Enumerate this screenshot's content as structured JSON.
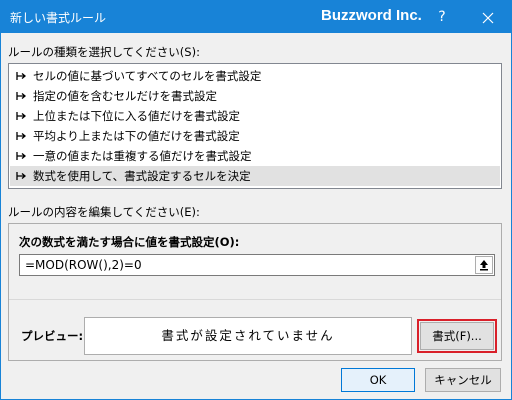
{
  "window": {
    "title": "新しい書式ルール",
    "brand": "Buzzword Inc.",
    "help_label": "?"
  },
  "rule_type": {
    "label": "ルールの種類を選択してください(S):",
    "items": [
      "セルの値に基づいてすべてのセルを書式設定",
      "指定の値を含むセルだけを書式設定",
      "上位または下位に入る値だけを書式設定",
      "平均より上または下の値だけを書式設定",
      "一意の値または重複する値だけを書式設定",
      "数式を使用して、書式設定するセルを決定"
    ],
    "selected_index": 5
  },
  "rule_edit": {
    "label": "ルールの内容を編集してください(E):",
    "formula_label": "次の数式を満たす場合に値を書式設定(O):",
    "formula_value": "=MOD(ROW(),2)=0",
    "preview_label": "プレビュー:",
    "preview_text": "書式が設定されていません",
    "format_button": "書式(F)..."
  },
  "buttons": {
    "ok": "OK",
    "cancel": "キャンセル"
  },
  "colors": {
    "titlebar": "#1883d7",
    "highlight_border": "#d9202a",
    "selected_row": "#e1e1e1"
  }
}
